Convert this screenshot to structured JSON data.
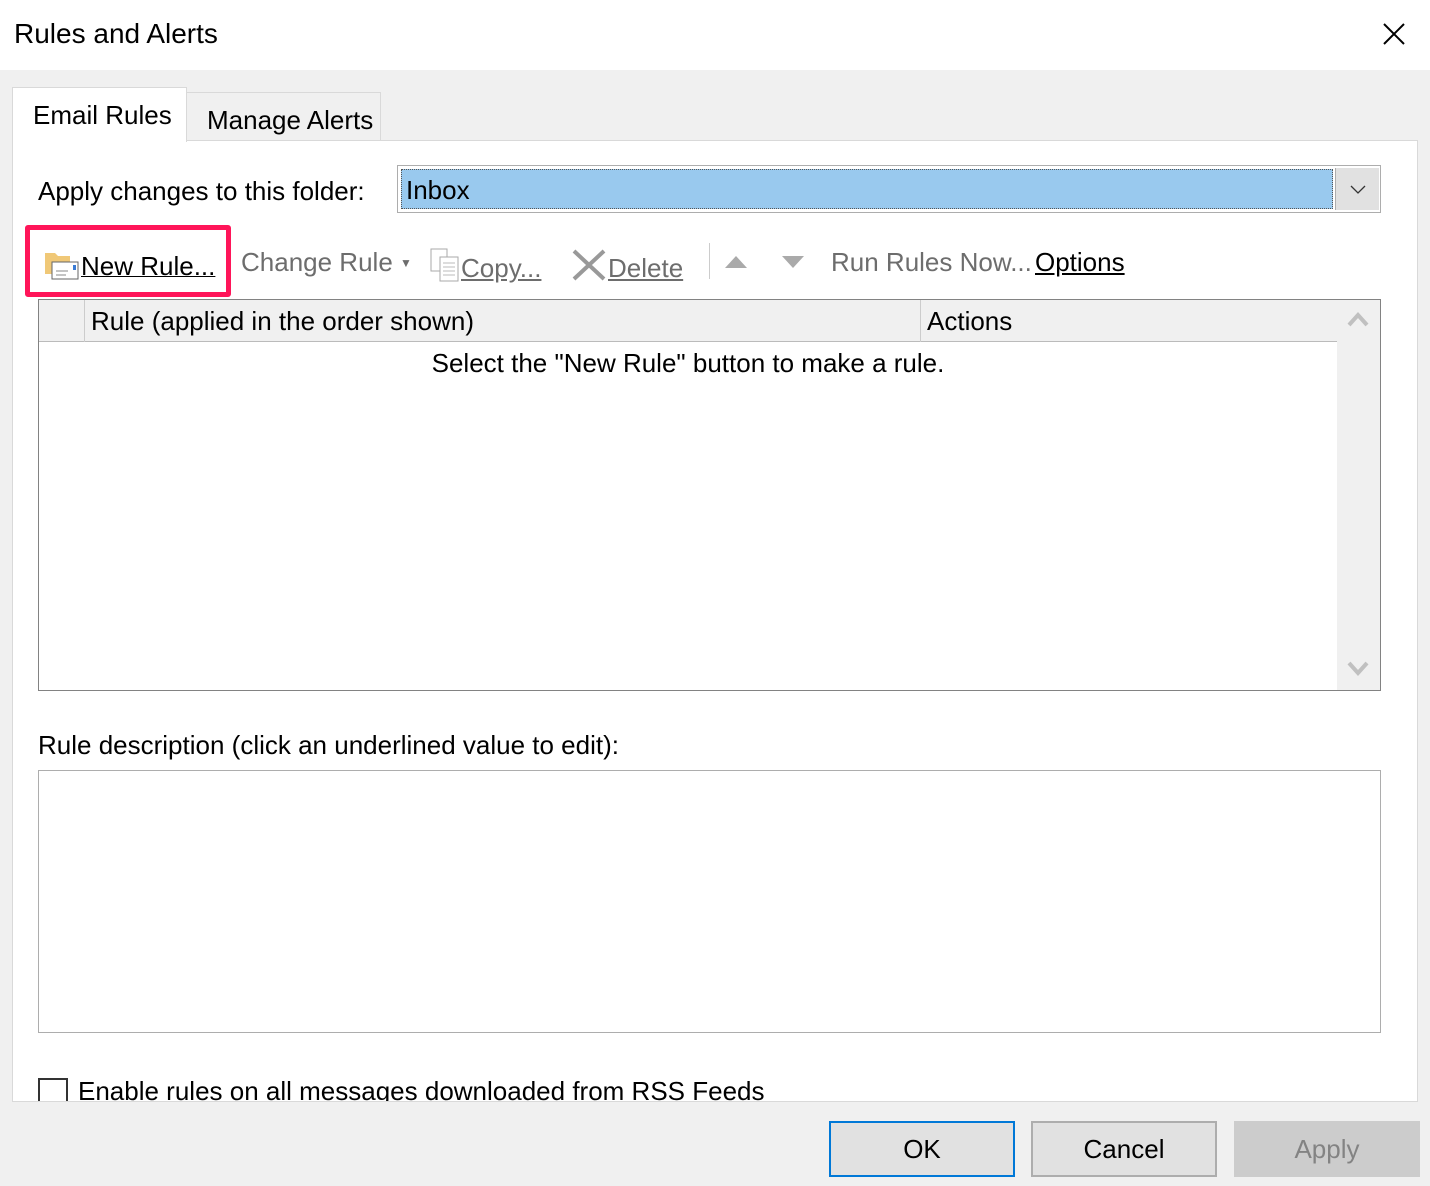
{
  "window": {
    "title": "Rules and Alerts"
  },
  "tabs": [
    {
      "label": "Email Rules",
      "active": true
    },
    {
      "label": "Manage Alerts",
      "active": false
    }
  ],
  "folder": {
    "label": "Apply changes to this folder:",
    "value": "Inbox"
  },
  "toolbar": {
    "new_rule": "New Rule...",
    "change_rule": "Change Rule",
    "copy": "Copy...",
    "delete": "Delete",
    "run_rules": "Run Rules Now...",
    "options": "Options"
  },
  "rules_list": {
    "columns": [
      "Rule (applied in the order shown)",
      "Actions"
    ],
    "empty_message": "Select the \"New Rule\" button to make a rule."
  },
  "description": {
    "label": "Rule description (click an underlined value to edit):"
  },
  "rss": {
    "label": "Enable rules on all messages downloaded from RSS Feeds",
    "checked": false
  },
  "buttons": {
    "ok": "OK",
    "cancel": "Cancel",
    "apply": "Apply"
  },
  "colors": {
    "highlight": "#ff1559",
    "selection": "#99c9ee",
    "focus": "#0078d7"
  }
}
